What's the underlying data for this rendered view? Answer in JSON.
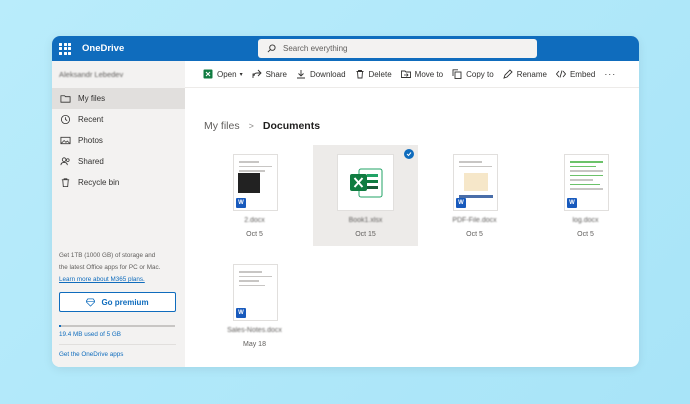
{
  "app": {
    "brand": "OneDrive",
    "account_name": "Aleksandr Lebedev",
    "accent_color": "#0f6cbd"
  },
  "search": {
    "placeholder": "Search everything",
    "icon": "search-icon"
  },
  "sidebar": {
    "items": [
      {
        "label": "My files",
        "icon": "folder-icon",
        "active": true
      },
      {
        "label": "Recent",
        "icon": "history-icon",
        "active": false
      },
      {
        "label": "Photos",
        "icon": "photo-icon",
        "active": false
      },
      {
        "label": "Shared",
        "icon": "people-icon",
        "active": false
      },
      {
        "label": "Recycle bin",
        "icon": "trash-icon",
        "active": false
      }
    ],
    "promo_text_1": "Get 1TB (1000 GB) of storage and",
    "promo_text_2": "the latest Office apps for PC or Mac.",
    "promo_link": "Learn more about M365 plans.",
    "premium_button": "Go premium",
    "storage_text": "19.4 MB used of 5 GB",
    "storage_used_fraction": 0.004,
    "get_apps": "Get the OneDrive apps"
  },
  "commands": [
    {
      "label": "Open",
      "icon": "excel-icon",
      "dropdown": true
    },
    {
      "label": "Share",
      "icon": "share-icon"
    },
    {
      "label": "Download",
      "icon": "download-icon"
    },
    {
      "label": "Delete",
      "icon": "trash-icon"
    },
    {
      "label": "Move to",
      "icon": "move-icon"
    },
    {
      "label": "Copy to",
      "icon": "copy-icon"
    },
    {
      "label": "Rename",
      "icon": "rename-icon"
    },
    {
      "label": "Embed",
      "icon": "embed-icon"
    }
  ],
  "more_label": "···",
  "breadcrumb": {
    "root": "My files",
    "current": "Documents"
  },
  "files": [
    {
      "name": "2.docx",
      "date": "Oct 5",
      "type": "word",
      "selected": false
    },
    {
      "name": "Book1.xlsx",
      "date": "Oct 15",
      "type": "excel",
      "selected": true
    },
    {
      "name": "PDF-File.docx",
      "date": "Oct 5",
      "type": "word",
      "selected": false
    },
    {
      "name": "log.docx",
      "date": "Oct 5",
      "type": "word",
      "selected": false
    },
    {
      "name": "Sales-Notes.docx",
      "date": "May 18",
      "type": "word",
      "selected": false
    }
  ]
}
